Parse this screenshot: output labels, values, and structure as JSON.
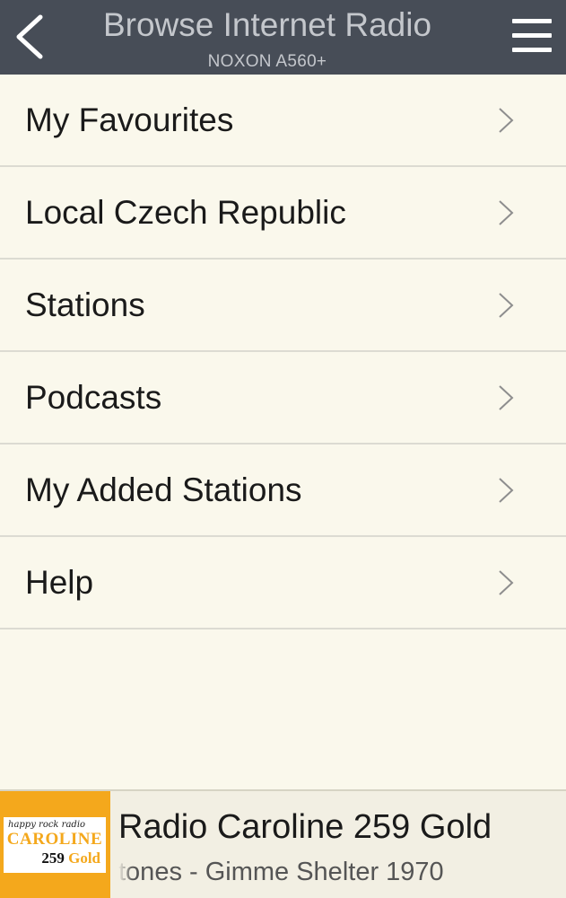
{
  "header": {
    "title": "Browse Internet Radio",
    "subtitle": "NOXON A560+",
    "back_icon": "chevron-left-icon",
    "menu_icon": "hamburger-menu-icon"
  },
  "menu": {
    "items": [
      {
        "label": "My Favourites"
      },
      {
        "label": "Local Czech Republic"
      },
      {
        "label": "Stations"
      },
      {
        "label": "Podcasts"
      },
      {
        "label": "My Added Stations"
      },
      {
        "label": "Help"
      }
    ],
    "item_icon": "chevron-right-icon"
  },
  "now_playing": {
    "station": "Radio Caroline 259 Gold",
    "track": "tones - Gimme Shelter 1970",
    "logo": {
      "tagline": "happy rock radio",
      "name": "CAROLINE",
      "number": "259",
      "gold": "Gold"
    }
  },
  "colors": {
    "header_bg": "#474d57",
    "header_text": "#c4c7cc",
    "page_bg": "#faf8ec",
    "logo_orange": "#f4a81c"
  }
}
